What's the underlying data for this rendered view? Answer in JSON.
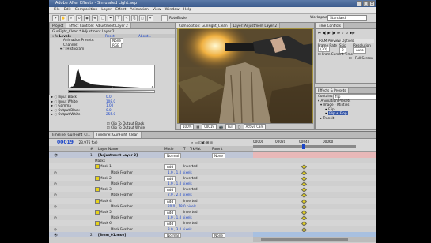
{
  "app": {
    "title": "Adobe After Effects - Simulated Light.aep"
  },
  "window_buttons": [
    "_",
    "□",
    "×"
  ],
  "menu": [
    "File",
    "Edit",
    "Composition",
    "Layer",
    "Effect",
    "Animation",
    "View",
    "Window",
    "Help"
  ],
  "toolbar": {
    "rotobezier_label": "RotoBezier",
    "workspace_label": "Workspace:",
    "workspace_value": "Standard"
  },
  "effect_controls": {
    "tab_project": "Project",
    "tab_effects": "Effect Controls: Adjustment Layer 2",
    "subtitle": "GunFight_Clean * Adjustment Layer 2",
    "effect_name": "Levels",
    "reset_label": "Reset",
    "about_label": "About...",
    "presets_label": "Animation Presets:",
    "presets_value": "None",
    "channel_label": "Channel:",
    "channel_value": "RGB",
    "histogram_label": "Histogram",
    "params": [
      {
        "label": "Input Black",
        "value": "0.0"
      },
      {
        "label": "Input White",
        "value": "108.0"
      },
      {
        "label": "Gamma",
        "value": "1.00"
      },
      {
        "label": "Output Black",
        "value": "0.0"
      },
      {
        "label": "Output White",
        "value": "255.0"
      }
    ],
    "clip_black": "Clip To Output Black",
    "clip_white": "Clip To Output White"
  },
  "composition": {
    "tab_comp": "Composition: GunFight_Clean",
    "tab_layer": "Layer: Adjustment Layer 2",
    "footer": {
      "zoom": "100%",
      "time": "00019",
      "resolution": "Full",
      "camera": "Active Cam"
    }
  },
  "time_controls": {
    "tab": "Time Controls",
    "ram_preview": "RAM Preview Options",
    "frame_rate_label": "Frame Rate",
    "frame_rate": "(30)",
    "skip_label": "Skip",
    "skip": "0",
    "resolution_label": "Resolution",
    "resolution": "Auto",
    "from_current": "From Current Time",
    "full_screen": "Full Screen"
  },
  "effects_presets": {
    "tab": "Effects & Presets",
    "contains_label": "Contains:",
    "search_value": "flip",
    "tree": [
      "Animation Presets",
      "Image - Utilities",
      "Flip",
      "Flip + Flop",
      "Transit"
    ]
  },
  "timeline": {
    "tab1": "Timeline: GunFight_Cl...",
    "tab2": "Timeline: GunFight_Clean",
    "timecode": "00019",
    "fps": "(23.976 fps)",
    "headers": {
      "num": "#",
      "layer_name": "Layer Name",
      "mode": "Mode",
      "t": "T",
      "trkmat": "TrkMat",
      "parent": "Parent"
    },
    "ruler": [
      "00000",
      "00020",
      "00040",
      "00060"
    ],
    "layers": [
      {
        "kind": "layer",
        "num": "1",
        "name": "[Adjustment Layer 2]",
        "mode": "Normal",
        "parent": "None"
      },
      {
        "kind": "group",
        "name": "Masks"
      },
      {
        "kind": "mask",
        "name": "Mask 1",
        "mode": "Add",
        "inverted": "Inverted"
      },
      {
        "kind": "feather",
        "name": "Mask Feather",
        "value": "1.0 , 1.0 pixels"
      },
      {
        "kind": "mask",
        "name": "Mask 2",
        "mode": "Add",
        "inverted": "Inverted"
      },
      {
        "kind": "feather",
        "name": "Mask Feather",
        "value": "1.0 , 1.0 pixels"
      },
      {
        "kind": "mask",
        "name": "Mask 3",
        "mode": "Add",
        "inverted": "Inverted"
      },
      {
        "kind": "feather",
        "name": "Mask Feather",
        "value": "2.0 , 2.0 pixels"
      },
      {
        "kind": "mask",
        "name": "Mask 4",
        "mode": "Add",
        "inverted": "Inverted"
      },
      {
        "kind": "feather",
        "name": "Mask Feather",
        "value": "20.0 , 18.0 pixels"
      },
      {
        "kind": "mask",
        "name": "Mask 5",
        "mode": "Add",
        "inverted": "Inverted"
      },
      {
        "kind": "feather",
        "name": "Mask Feather",
        "value": "1.0 , 1.0 pixels"
      },
      {
        "kind": "mask",
        "name": "Mask 6",
        "mode": "Add",
        "inverted": "Inverted"
      },
      {
        "kind": "feather",
        "name": "Mask Feather",
        "value": "3.0 , 3.0 pixels"
      },
      {
        "kind": "layer",
        "num": "2",
        "name": "[Bmm_01.mov]",
        "mode": "Normal",
        "parent": "None"
      }
    ]
  },
  "colors": {
    "accent_blue": "#1a44c8",
    "title_blue": "#3a5a8c",
    "layer_bar_pink": "#e8b8b8",
    "mask_yellow": "#e6d21a",
    "cti_red": "#e02020"
  }
}
